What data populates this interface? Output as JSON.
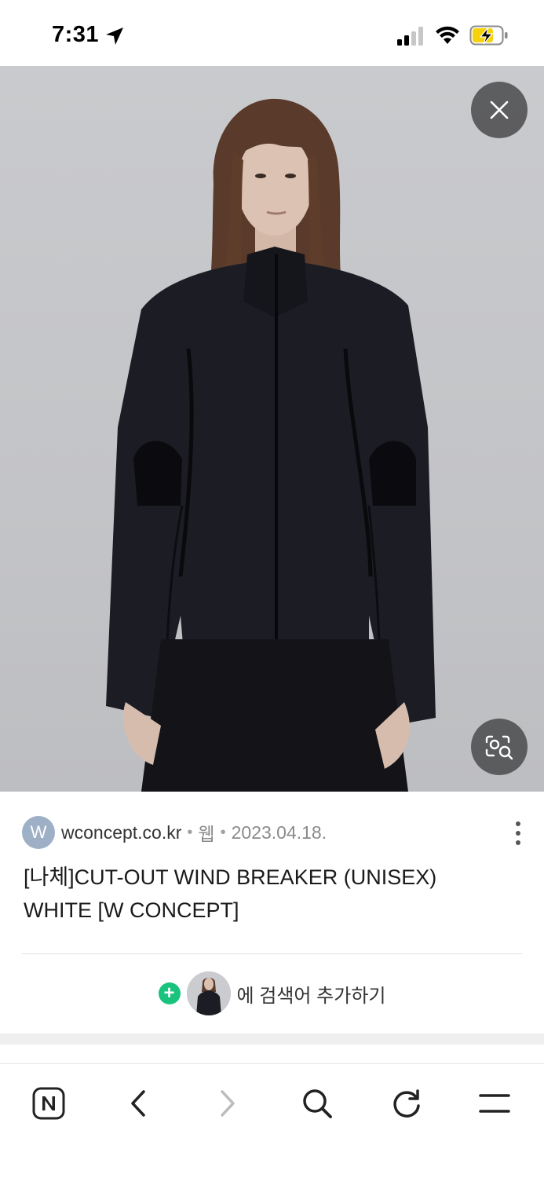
{
  "status_bar": {
    "time": "7:31",
    "icons": [
      "location-arrow-icon",
      "cellular-signal-icon",
      "wifi-icon",
      "battery-charging-icon"
    ],
    "battery_color": "#f5d20a"
  },
  "viewer": {
    "image_alt": "model wearing black cut-out wind breaker",
    "close_icon": "close-icon",
    "lens_icon": "image-search-icon",
    "background_color": "#c6c7ca"
  },
  "result": {
    "favicon_letter": "W",
    "domain": "wconcept.co.kr",
    "separator": "•",
    "type": "웹",
    "date": "2023.04.18.",
    "title": "[나체]CUT-OUT WIND BREAKER (UNISEX) WHITE [W CONCEPT]",
    "more_icon": "more-vertical-icon"
  },
  "add_search": {
    "plus": "+",
    "label": "에 검색어 추가하기",
    "accent": "#19c37d"
  },
  "toolbar": {
    "items": [
      {
        "name": "home",
        "icon": "naver-n-icon",
        "glyph": "N"
      },
      {
        "name": "back",
        "icon": "chevron-left-icon"
      },
      {
        "name": "forward",
        "icon": "chevron-right-icon"
      },
      {
        "name": "search",
        "icon": "search-icon"
      },
      {
        "name": "refresh",
        "icon": "refresh-icon"
      },
      {
        "name": "menu",
        "icon": "menu-icon"
      }
    ]
  }
}
